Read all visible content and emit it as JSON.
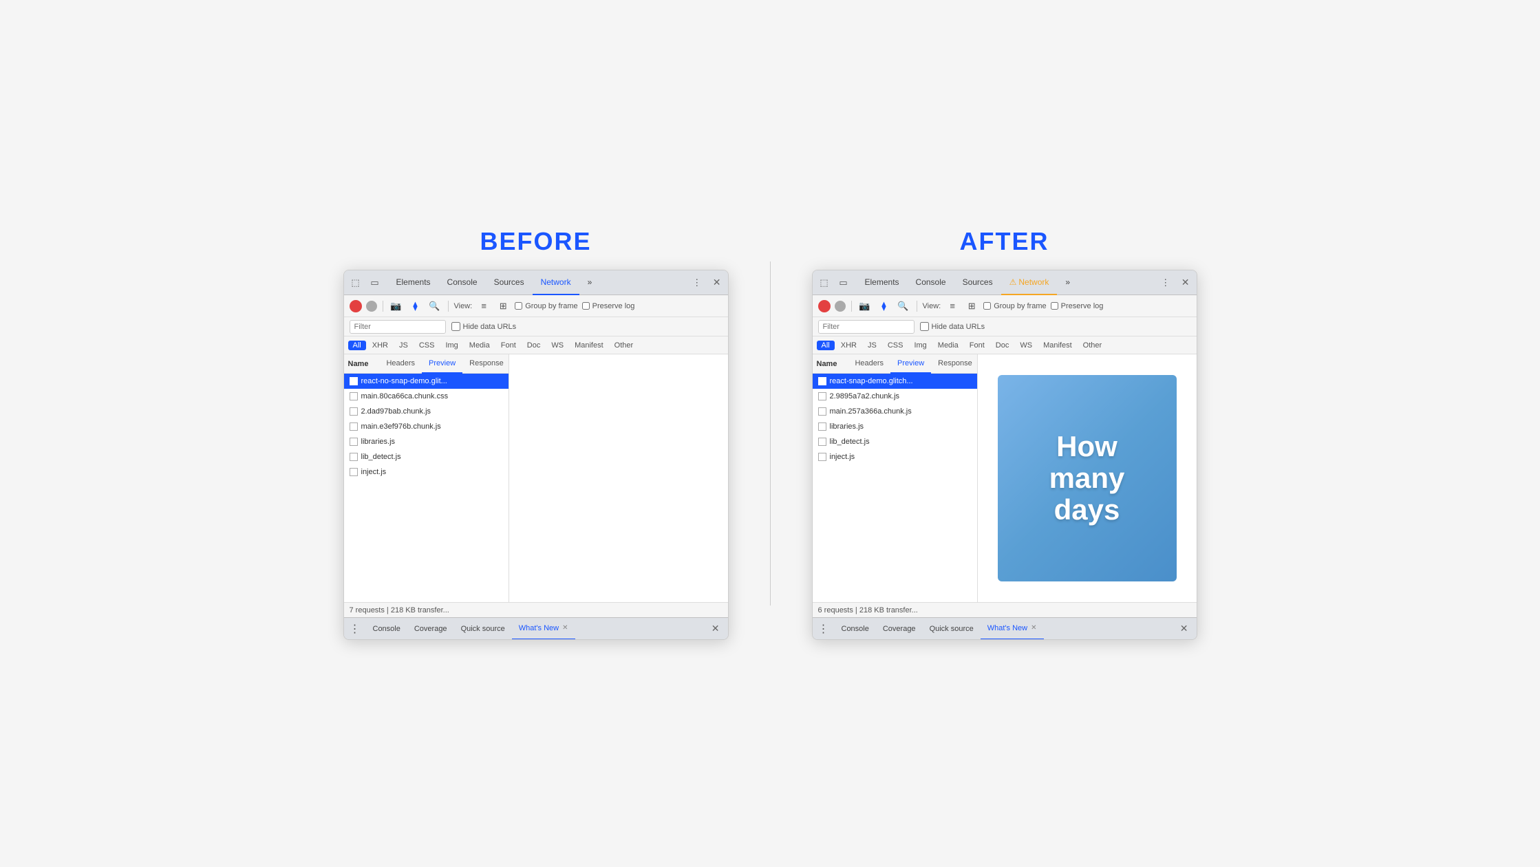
{
  "labels": {
    "before": "BEFORE",
    "after": "AFTER"
  },
  "before": {
    "tabs": [
      "Elements",
      "Console",
      "Sources",
      "Network",
      "»"
    ],
    "active_tab": "Network",
    "toolbar": {
      "view_label": "View:",
      "group_by_frame": "Group by frame",
      "preserve_log": "Preserve log"
    },
    "filter": {
      "placeholder": "Filter",
      "hide_data_urls": "Hide data URLs"
    },
    "type_filters": [
      "All",
      "XHR",
      "JS",
      "CSS",
      "Img",
      "Media",
      "Font",
      "Doc",
      "WS",
      "Manifest",
      "Other"
    ],
    "active_type": "All",
    "columns": {
      "name": "Name",
      "tabs": [
        "Headers",
        "Preview",
        "Response",
        "»"
      ],
      "active_col_tab": "Preview"
    },
    "files": [
      {
        "name": "react-no-snap-demo.glit...",
        "selected": true
      },
      {
        "name": "main.80ca66ca.chunk.css",
        "selected": false
      },
      {
        "name": "2.dad97bab.chunk.js",
        "selected": false
      },
      {
        "name": "main.e3ef976b.chunk.js",
        "selected": false
      },
      {
        "name": "libraries.js",
        "selected": false
      },
      {
        "name": "lib_detect.js",
        "selected": false
      },
      {
        "name": "inject.js",
        "selected": false
      }
    ],
    "status": "7 requests | 218 KB transfer...",
    "drawer_tabs": [
      "Console",
      "Coverage",
      "Quick source",
      "What's New"
    ],
    "active_drawer_tab": "What's New",
    "preview_type": "empty"
  },
  "after": {
    "tabs": [
      "Elements",
      "Console",
      "Sources",
      "Network",
      "»"
    ],
    "active_tab": "Network",
    "active_tab_warning": true,
    "toolbar": {
      "view_label": "View:",
      "group_by_frame": "Group by frame",
      "preserve_log": "Preserve log"
    },
    "filter": {
      "placeholder": "Filter",
      "hide_data_urls": "Hide data URLs"
    },
    "type_filters": [
      "All",
      "XHR",
      "JS",
      "CSS",
      "Img",
      "Media",
      "Font",
      "Doc",
      "WS",
      "Manifest",
      "Other"
    ],
    "active_type": "All",
    "columns": {
      "name": "Name",
      "tabs": [
        "Headers",
        "Preview",
        "Response",
        "»"
      ],
      "active_col_tab": "Preview"
    },
    "files": [
      {
        "name": "react-snap-demo.glitch...",
        "selected": true
      },
      {
        "name": "2.9895a7a2.chunk.js",
        "selected": false
      },
      {
        "name": "main.257a366a.chunk.js",
        "selected": false
      },
      {
        "name": "libraries.js",
        "selected": false
      },
      {
        "name": "lib_detect.js",
        "selected": false
      },
      {
        "name": "inject.js",
        "selected": false
      }
    ],
    "status": "6 requests | 218 KB transfer...",
    "drawer_tabs": [
      "Console",
      "Coverage",
      "Quick source",
      "What's New"
    ],
    "active_drawer_tab": "What's New",
    "preview_type": "image",
    "preview_text": "How many days"
  },
  "icons": {
    "record": "⏺",
    "stop": "🚫",
    "camera": "📷",
    "funnel": "⬦",
    "search": "🔍",
    "menu": "⋮",
    "close": "✕",
    "more": "»",
    "file": "□"
  }
}
